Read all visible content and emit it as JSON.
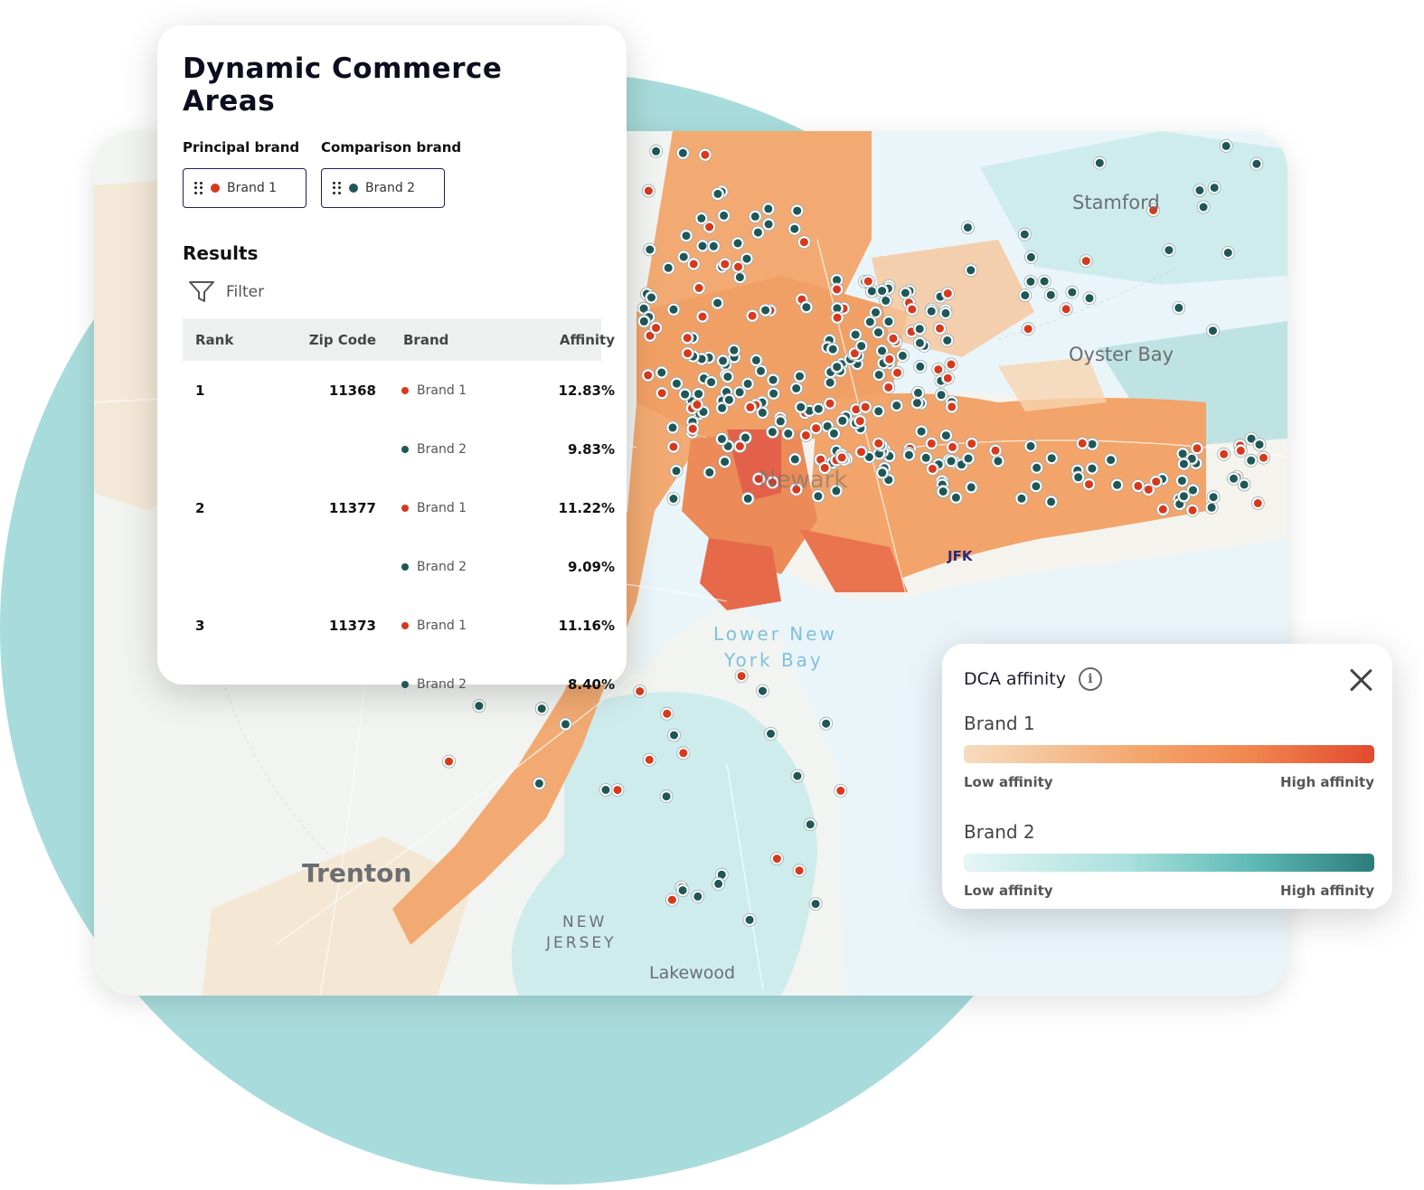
{
  "panel": {
    "title": "Dynamic Commerce Areas",
    "principal_label": "Principal brand",
    "comparison_label": "Comparison brand",
    "principal_value": "Brand 1",
    "comparison_value": "Brand 2",
    "results_title": "Results",
    "filter_label": "Filter"
  },
  "table": {
    "headers": {
      "rank": "Rank",
      "zip": "Zip Code",
      "brand": "Brand",
      "affinity": "Affinity"
    },
    "rows": [
      {
        "rank": "1",
        "zip": "11368",
        "brand": "Brand 1",
        "affinity": "12.83%",
        "brand_color": "#d63a1e"
      },
      {
        "rank": "",
        "zip": "",
        "brand": "Brand 2",
        "affinity": "9.83%",
        "brand_color": "#1f5757"
      },
      {
        "rank": "2",
        "zip": "11377",
        "brand": "Brand 1",
        "affinity": "11.22%",
        "brand_color": "#d63a1e"
      },
      {
        "rank": "",
        "zip": "",
        "brand": "Brand 2",
        "affinity": "9.09%",
        "brand_color": "#1f5757"
      },
      {
        "rank": "3",
        "zip": "11373",
        "brand": "Brand 1",
        "affinity": "11.16%",
        "brand_color": "#d63a1e"
      },
      {
        "rank": "",
        "zip": "",
        "brand": "Brand 2",
        "affinity": "8.40%",
        "brand_color": "#1f5757"
      }
    ]
  },
  "legend": {
    "title": "DCA affinity",
    "brand1": "Brand 1",
    "brand2": "Brand 2",
    "low": "Low affinity",
    "high": "High affinity"
  },
  "map_labels": {
    "stamford": "Stamford",
    "oyster_bay": "Oyster Bay",
    "newark": "Newark",
    "jfk": "JFK",
    "lower_bay_1": "Lower New",
    "lower_bay_2": "York Bay",
    "trenton": "Trenton",
    "nj_1": "NEW",
    "nj_2": "JERSEY",
    "lakewood": "Lakewood"
  },
  "colors": {
    "brand1": "#d63a1e",
    "brand2": "#1f5757",
    "orange_area": "#f2aa72",
    "teal_area": "#bfe6e6",
    "water": "#e8f4fa"
  }
}
